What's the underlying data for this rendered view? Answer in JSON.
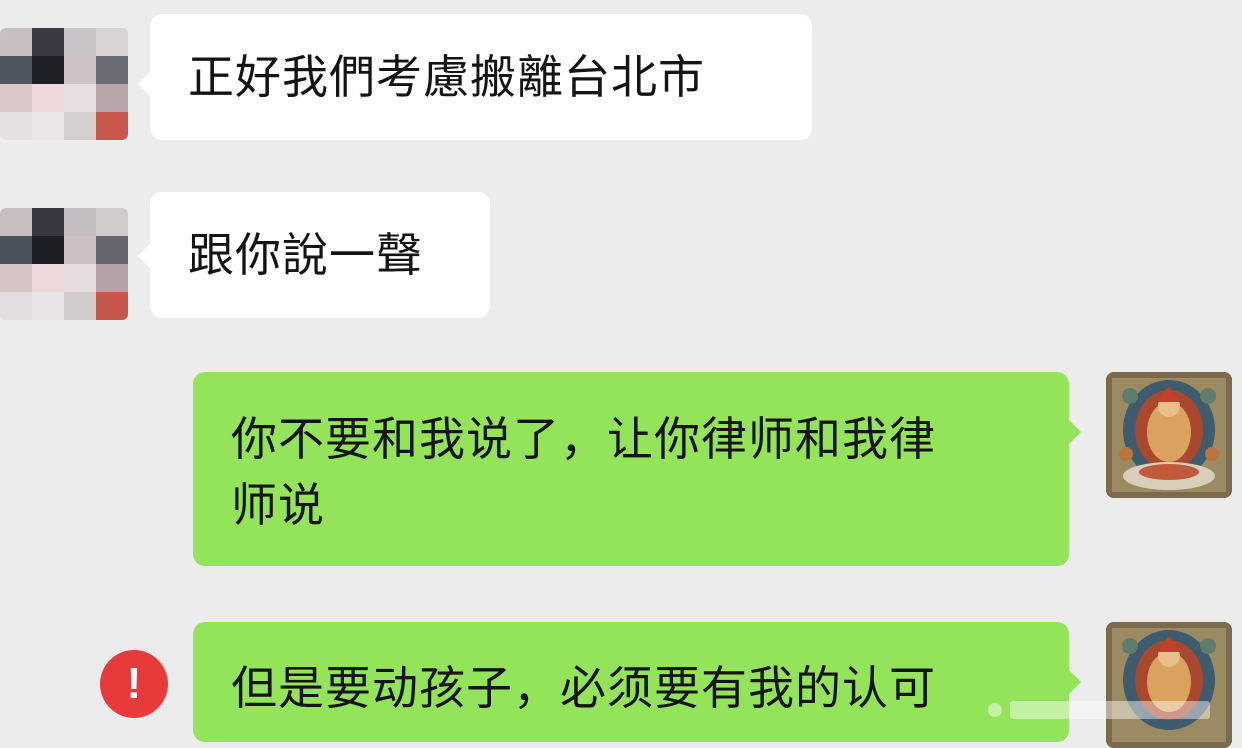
{
  "messages": [
    {
      "side": "incoming",
      "text": "正好我們考慮搬離台北市"
    },
    {
      "side": "incoming",
      "text": "跟你說一聲"
    },
    {
      "side": "outgoing",
      "lines": [
        "你不要和我说了，让你律师和我律",
        "师说"
      ]
    },
    {
      "side": "outgoing",
      "text": "但是要动孩子，必须要有我的认可",
      "status": "error"
    }
  ],
  "icons": {
    "error": "!",
    "incoming_avatar": "pixelated-avatar-icon",
    "outgoing_avatar": "thangka-avatar-icon"
  },
  "colors": {
    "background": "#ececec",
    "incoming_bubble": "#ffffff",
    "outgoing_bubble": "#93e45b",
    "error": "#e73a3a"
  }
}
